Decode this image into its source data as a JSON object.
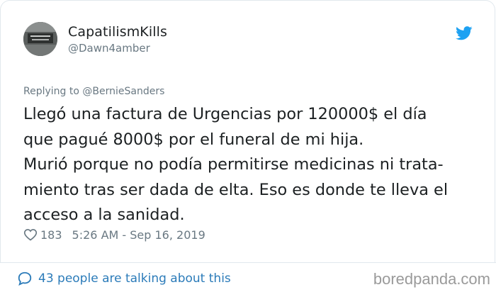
{
  "user": {
    "display_name": "CapatilismKills",
    "handle": "@Dawn4amber"
  },
  "tweet": {
    "replying_to": "Replying to @BernieSanders",
    "text": "Llegó una factura de Urgencias por 120000$ el día\nque pagué 8000$ por el funeral de mi hija.\nMurió porque no podía permitirse medicinas ni trata-\nmiento tras ser dada de elta. Eso es donde te lleva el\nacceso a la sanidad.",
    "likes": "183",
    "timestamp": "5:26 AM - Sep 16, 2019"
  },
  "footer": {
    "talking_text": "43 people are talking about this"
  },
  "watermark": "boredpanda.com",
  "colors": {
    "twitter_blue": "#1da1f2",
    "link_blue": "#2b7bb9",
    "muted_gray": "#697882"
  },
  "icons": [
    "twitter-bird-icon",
    "heart-icon",
    "speech-bubble-icon"
  ]
}
